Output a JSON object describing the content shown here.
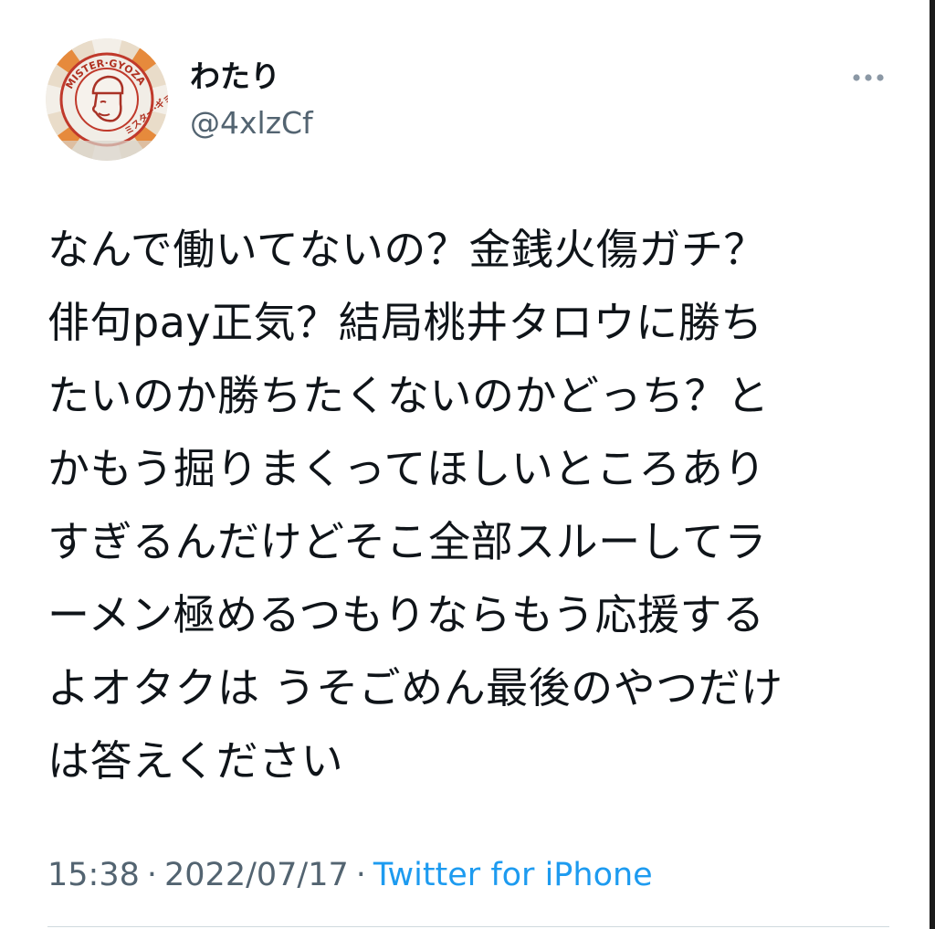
{
  "user": {
    "display_name": "わたり",
    "handle": "@4xlzCf",
    "avatar_icon": "mister-gyoza-logo-avatar",
    "avatar_text": "MISTER GYOZA ミスターギョーザ"
  },
  "menu": {
    "more_icon": "more-horizontal-icon"
  },
  "tweet": {
    "lines": [
      "なんで働いてないの？金銭火傷ガチ？",
      "俳句pay正気？結局桃井タロウに勝ち",
      "たいのか勝ちたくないのかどっち？と",
      "かもう掘りまくってほしいところあり",
      "すぎるんだけどそこ全部スルーしてラ",
      "ーメン極めるつもりならもう応援する",
      "よオタクは うそごめん最後のやつだけ",
      "は答えください"
    ]
  },
  "meta": {
    "time": "15:38",
    "separator": "·",
    "date": "2022/07/17",
    "source": "Twitter for iPhone"
  },
  "colors": {
    "text": "#0f1419",
    "secondary": "#536471",
    "link": "#1d9bf0",
    "divider": "#cfd9de"
  }
}
